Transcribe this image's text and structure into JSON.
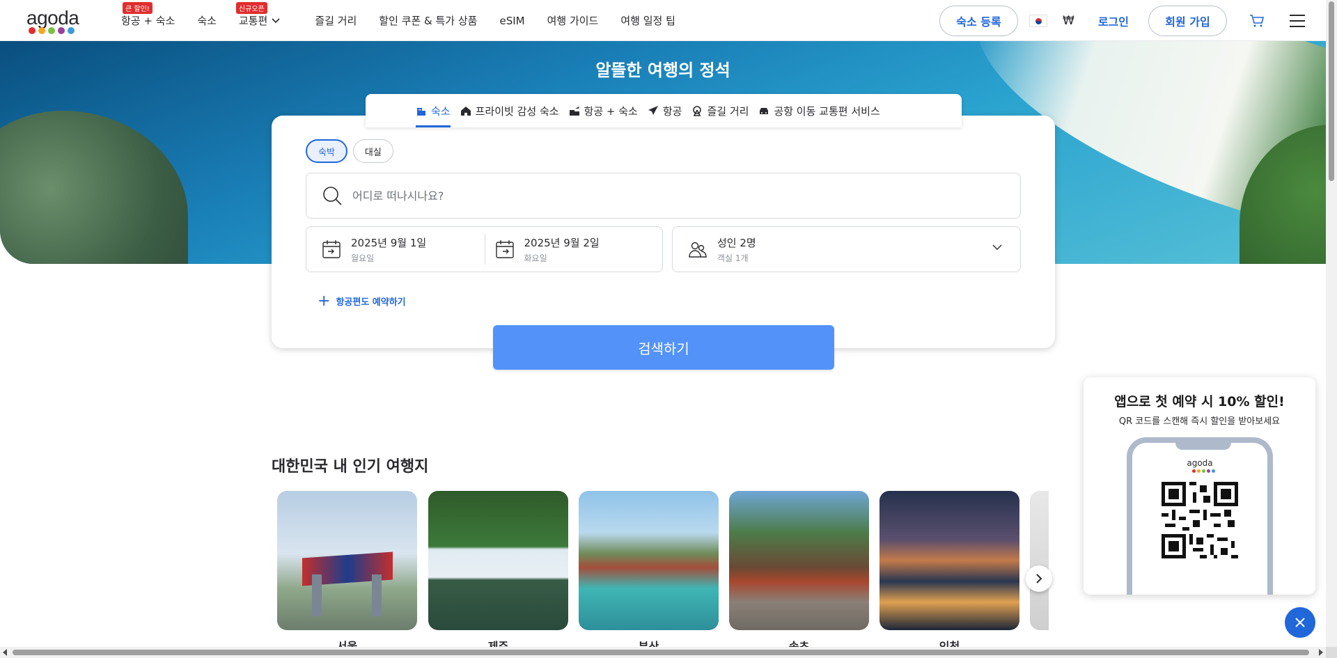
{
  "header": {
    "logo_text": "agoda",
    "logo_colors": [
      "#e12d2d",
      "#f5a623",
      "#7ac143",
      "#9b3fa0",
      "#3a9bdc"
    ],
    "nav": [
      {
        "label": "항공 + 숙소",
        "badge": "큰 할인!"
      },
      {
        "label": "숙소",
        "badge": ""
      },
      {
        "label": "교통편",
        "badge": "신규오픈"
      },
      {
        "label": "즐길 거리",
        "badge": ""
      },
      {
        "label": "할인 쿠폰 & 특가 상품",
        "badge": ""
      },
      {
        "label": "eSIM",
        "badge": ""
      },
      {
        "label": "여행 가이드",
        "badge": ""
      },
      {
        "label": "여행 일정 팁",
        "badge": ""
      }
    ],
    "list_property": "숙소 등록",
    "currency": "₩",
    "login": "로그인",
    "signup": "회원 가입"
  },
  "hero": {
    "title": "알뜰한 여행의 정석"
  },
  "tabs": [
    {
      "label": "숙소",
      "icon": "hotel-icon",
      "active": true
    },
    {
      "label": "프라이빗 감성 숙소",
      "icon": "home-icon",
      "active": false
    },
    {
      "label": "항공 + 숙소",
      "icon": "flight-hotel-icon",
      "active": false
    },
    {
      "label": "항공",
      "icon": "plane-icon",
      "active": false
    },
    {
      "label": "즐길 거리",
      "icon": "ferris-wheel-icon",
      "active": false
    },
    {
      "label": "공항 이동 교통편 서비스",
      "icon": "car-icon",
      "active": false
    }
  ],
  "search": {
    "stay_types": [
      {
        "label": "숙박",
        "active": true
      },
      {
        "label": "대실",
        "active": false
      }
    ],
    "destination_placeholder": "어디로 떠나시나요?",
    "check_in": {
      "date": "2025년 9월 1일",
      "day": "월요일"
    },
    "check_out": {
      "date": "2025년 9월 2일",
      "day": "화요일"
    },
    "guests": {
      "main": "성인 2명",
      "sub": "객실 1개"
    },
    "add_flight": "항공편도 예약하기",
    "search_button": "검색하기"
  },
  "popular": {
    "title": "대한민국 내 인기 여행지",
    "cities": [
      "서울",
      "제주",
      "부산",
      "속초",
      "인천"
    ]
  },
  "promo": {
    "title": "앱으로 첫 예약 시 10% 할인!",
    "subtitle": "QR 코드를 스캔해 즉시 할인을 받아보세요",
    "phone_logo": "agoda"
  },
  "colors": {
    "brand_blue": "#2067da",
    "search_button": "#5392f9",
    "badge_red": "#e12d2d"
  }
}
